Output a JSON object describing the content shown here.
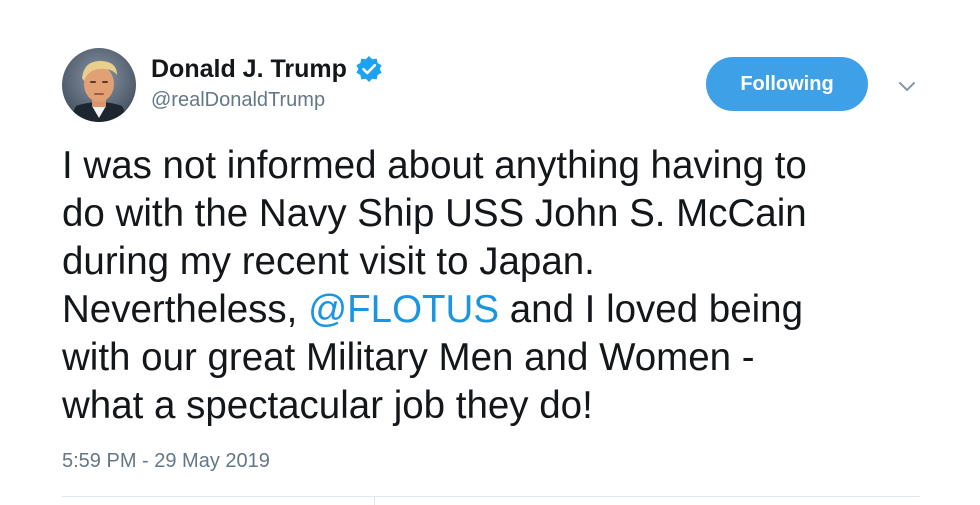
{
  "author": {
    "display_name": "Donald J. Trump",
    "handle": "@realDonaldTrump",
    "verified": true,
    "avatar_icon": "profile-photo"
  },
  "follow_button": {
    "label": "Following"
  },
  "menu": {
    "icon": "chevron-down-icon"
  },
  "tweet": {
    "line1": "I was not informed about anything having to",
    "line2": "do with the Navy Ship USS John S. McCain",
    "line3": "during my recent visit to Japan.",
    "line4_before": "Nevertheless, ",
    "mention": "@FLOTUS",
    "line4_after": " and I loved being",
    "line5": "with our great Military Men and Women -",
    "line6": "what a spectacular job they do!"
  },
  "timestamp": "5:59 PM - 29 May 2019",
  "colors": {
    "accent": "#1b95e0",
    "button": "#3ea1e7",
    "secondary_text": "#657786",
    "primary_text": "#14171a"
  }
}
